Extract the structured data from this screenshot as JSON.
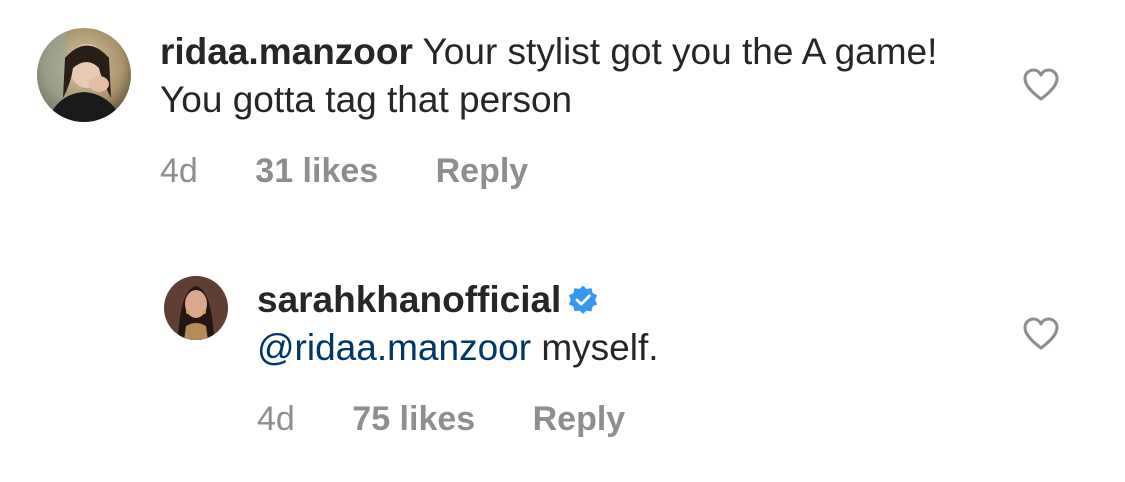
{
  "comments": [
    {
      "username": "ridaa.manzoor",
      "text": " Your stylist got you the A game! You gotta tag that person",
      "time": "4d",
      "likes": "31 likes",
      "reply_label": "Reply",
      "avatar_icon": "profile-photo-ridaa",
      "like_icon": "heart-outline-icon"
    },
    {
      "username": "sarahkhanofficial",
      "verified": true,
      "mention": "@ridaa.manzoor",
      "text": " myself.",
      "time": "4d",
      "likes": "75 likes",
      "reply_label": "Reply",
      "avatar_icon": "profile-photo-sarahkhan",
      "like_icon": "heart-outline-icon"
    }
  ],
  "colors": {
    "text": "#262626",
    "meta": "#8e8e8e",
    "mention": "#003569",
    "verified_badge": "#3897f0"
  }
}
